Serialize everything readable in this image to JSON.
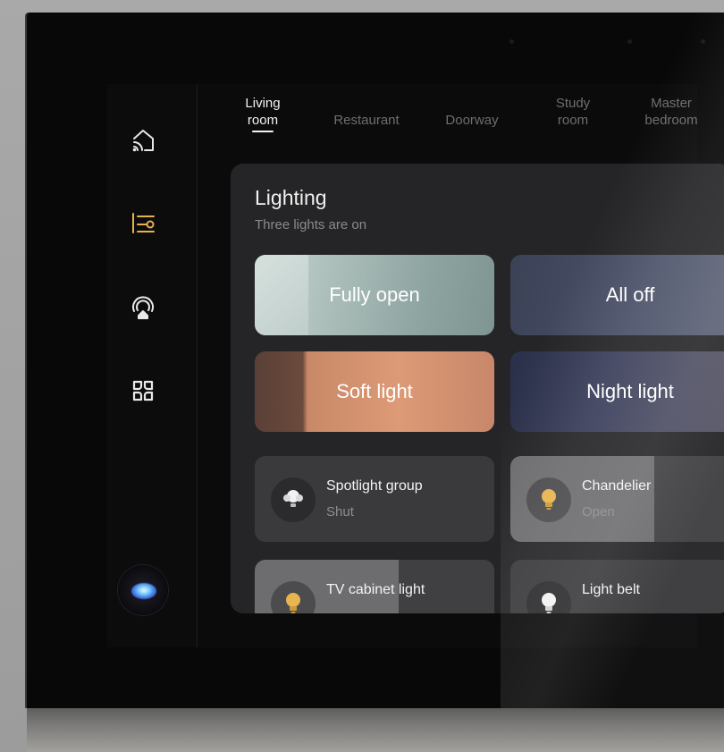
{
  "tabs": [
    {
      "label_line1": "Living",
      "label_line2": "room",
      "active": true
    },
    {
      "label_line1": "Restaurant",
      "label_line2": ""
    },
    {
      "label_line1": "Doorway",
      "label_line2": ""
    },
    {
      "label_line1": "Study",
      "label_line2": "room"
    },
    {
      "label_line1": "Master",
      "label_line2": "bedroom"
    }
  ],
  "sidebar": {
    "items": [
      {
        "icon": "home-cast-icon",
        "active": false
      },
      {
        "icon": "sliders-icon",
        "active": true
      },
      {
        "icon": "smart-home-icon",
        "active": false
      },
      {
        "icon": "apps-grid-icon",
        "active": false
      }
    ],
    "assistant_icon": "voice-assistant-orb-icon"
  },
  "panel": {
    "title": "Lighting",
    "subtitle": "Three lights are on",
    "scenes": [
      {
        "label": "Fully open"
      },
      {
        "label": "All off"
      },
      {
        "label": "Soft light"
      },
      {
        "label": "Night light"
      }
    ],
    "devices": [
      {
        "name": "Spotlight group",
        "state": "Shut",
        "icon": "spotlight-bulb-icon",
        "on": false
      },
      {
        "name": "Chandelier",
        "state": "Open",
        "icon": "bulb-icon",
        "on": true
      },
      {
        "name": "TV cabinet light",
        "state": "",
        "icon": "bulb-icon",
        "on": true
      },
      {
        "name": "Light belt",
        "state": "",
        "icon": "bulb-icon",
        "on": false
      }
    ]
  },
  "colors": {
    "accent": "#e6b24a",
    "bulb_on": "#e8b54e",
    "bulb_off": "#f2f2f2",
    "panel": "#252527",
    "background": "#080808"
  }
}
